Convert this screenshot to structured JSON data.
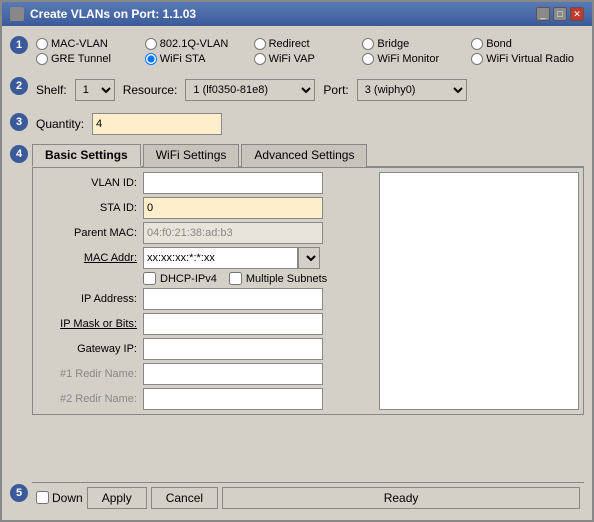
{
  "window": {
    "title": "Create VLANs on Port: 1.1.03"
  },
  "steps": {
    "step1_num": "1",
    "step2_num": "2",
    "step3_num": "3",
    "step4_num": "4",
    "step5_num": "5"
  },
  "radio_types": [
    {
      "id": "mac-vlan",
      "label": "MAC-VLAN",
      "checked": false
    },
    {
      "id": "8021q-vlan",
      "label": "802.1Q-VLAN",
      "checked": false
    },
    {
      "id": "redirect",
      "label": "Redirect",
      "checked": false
    },
    {
      "id": "bridge",
      "label": "Bridge",
      "checked": false
    },
    {
      "id": "bond",
      "label": "Bond",
      "checked": false
    },
    {
      "id": "gre-tunnel",
      "label": "GRE Tunnel",
      "checked": false
    },
    {
      "id": "wifi-sta",
      "label": "WiFi STA",
      "checked": true
    },
    {
      "id": "wifi-vap",
      "label": "WiFi VAP",
      "checked": false
    },
    {
      "id": "wifi-monitor",
      "label": "WiFi Monitor",
      "checked": false
    },
    {
      "id": "wifi-virtual-radio",
      "label": "WiFi Virtual Radio",
      "checked": false
    }
  ],
  "shelf": {
    "label": "Shelf:",
    "value": "1",
    "options": [
      "1"
    ]
  },
  "resource": {
    "label": "Resource:",
    "value": "1 (lf0350-81e8)",
    "options": [
      "1 (lf0350-81e8)"
    ]
  },
  "port": {
    "label": "Port:",
    "value": "3 (wiphy0)",
    "options": [
      "3 (wiphy0)"
    ]
  },
  "quantity": {
    "label": "Quantity:",
    "value": "4"
  },
  "tabs": [
    {
      "id": "basic",
      "label": "Basic Settings",
      "active": true
    },
    {
      "id": "wifi",
      "label": "WiFi Settings",
      "active": false
    },
    {
      "id": "advanced",
      "label": "Advanced Settings",
      "active": false
    }
  ],
  "basic_settings": {
    "vlan_id_label": "VLAN ID:",
    "vlan_id_value": "",
    "sta_id_label": "STA ID:",
    "sta_id_value": "0",
    "parent_mac_label": "Parent MAC:",
    "parent_mac_value": "04:f0:21:38:ad:b3",
    "mac_addr_label": "MAC Addr:",
    "mac_addr_value": "xx:xx:xx:*:*:xx",
    "dhcp_ipv4_label": "DHCP-IPv4",
    "multiple_subnets_label": "Multiple Subnets",
    "ip_address_label": "IP Address:",
    "ip_address_value": "",
    "ip_mask_label": "IP Mask or Bits:",
    "ip_mask_value": "",
    "gateway_ip_label": "Gateway IP:",
    "gateway_ip_value": "",
    "redir1_label": "#1 Redir Name:",
    "redir1_value": "",
    "redir2_label": "#2 Redir Name:",
    "redir2_value": ""
  },
  "bottom": {
    "down_label": "Down",
    "apply_label": "Apply",
    "cancel_label": "Cancel",
    "status": "Ready"
  }
}
